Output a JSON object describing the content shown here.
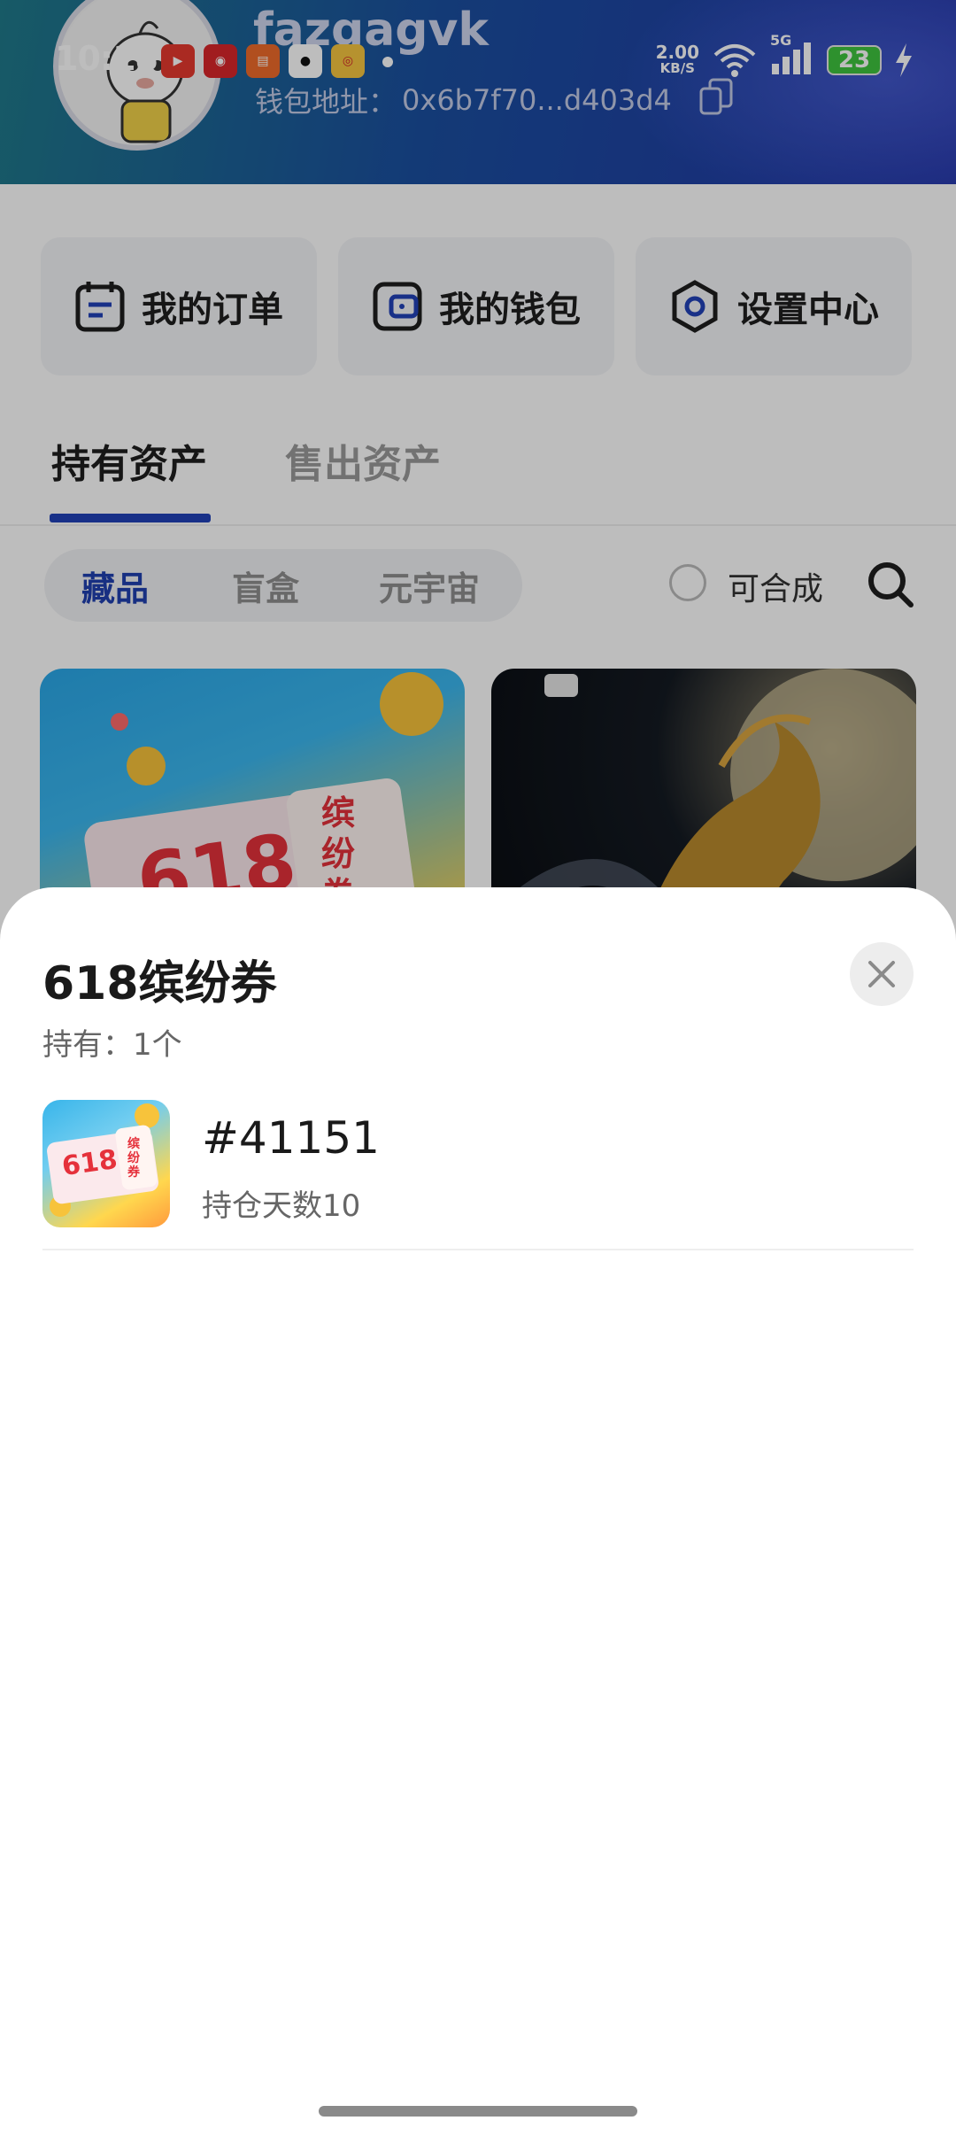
{
  "status_bar": {
    "time": "10:18",
    "net_speed_value": "2.00",
    "net_speed_unit": "KB/S",
    "signal_label": "5G",
    "battery": "23"
  },
  "profile": {
    "username": "fazgagvk",
    "wallet_label": "钱包地址：",
    "wallet_address": "0x6b7f70...d403d4"
  },
  "quick_actions": [
    {
      "label": "我的订单",
      "icon": "order-icon"
    },
    {
      "label": "我的钱包",
      "icon": "wallet-icon"
    },
    {
      "label": "设置中心",
      "icon": "settings-icon"
    }
  ],
  "tabs": [
    {
      "label": "持有资产",
      "active": true
    },
    {
      "label": "售出资产",
      "active": false
    }
  ],
  "segments": [
    {
      "label": "藏品",
      "active": true
    },
    {
      "label": "盲盒",
      "active": false
    },
    {
      "label": "元宇宙",
      "active": false
    }
  ],
  "filter": {
    "label": "可合成",
    "checked": false
  },
  "cards": [
    {
      "thumb_text": "618",
      "thumb_tag": "缤纷券"
    },
    {
      "thumb_text": "",
      "thumb_tag": ""
    }
  ],
  "sheet": {
    "title": "618缤纷券",
    "holding": "持有：1个",
    "items": [
      {
        "id": "#41151",
        "days": "持仓天数10",
        "thumb_text": "618",
        "thumb_tag": "缤纷券"
      }
    ]
  },
  "colors": {
    "accent": "#2142b8",
    "header_start": "#1f7a8a",
    "header_end": "#2436a8"
  }
}
